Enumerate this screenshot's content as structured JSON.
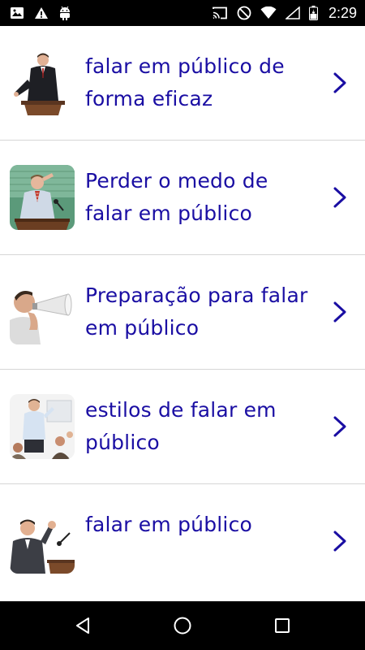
{
  "status_bar": {
    "time": "2:29",
    "left_icons": [
      "image-icon",
      "warning-icon",
      "android-icon"
    ],
    "right_icons": [
      "cast-icon",
      "do-not-disturb-icon",
      "wifi-icon",
      "signal-icon",
      "battery-icon"
    ]
  },
  "list": {
    "items": [
      {
        "label": "falar em público de forma eficaz",
        "thumb": "speaker-podium-image"
      },
      {
        "label": "Perder o medo de falar em público",
        "thumb": "nervous-speaker-image"
      },
      {
        "label": "Preparação para falar em público",
        "thumb": "megaphone-man-image"
      },
      {
        "label": "estilos de falar em público",
        "thumb": "presenter-audience-image"
      },
      {
        "label": "falar em público",
        "thumb": "excited-speaker-image"
      }
    ]
  },
  "colors": {
    "accent": "#1a0ea3",
    "status_bar_bg": "#000000",
    "divider": "#d6d6d6"
  },
  "nav_bar": {
    "buttons": [
      "back-icon",
      "home-icon",
      "recents-icon"
    ]
  }
}
